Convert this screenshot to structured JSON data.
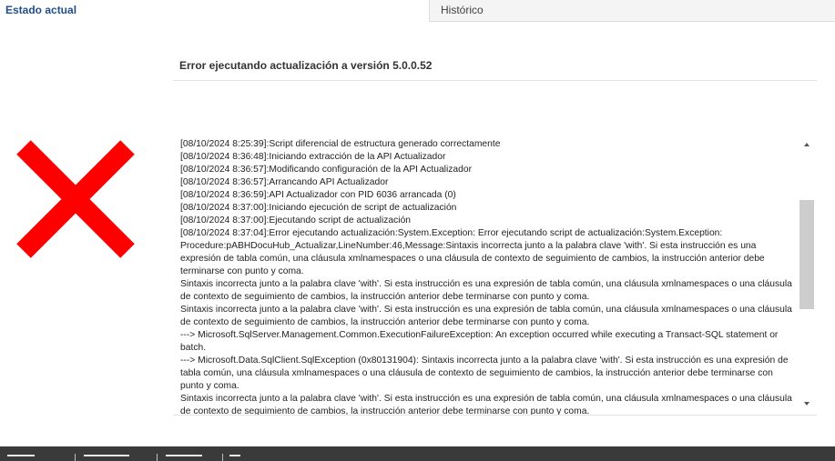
{
  "tabs": {
    "current": "Estado actual",
    "history": "Histórico"
  },
  "status": {
    "heading": "Error ejecutando actualización a versión 5.0.0.52",
    "icon": "error-x-icon",
    "icon_color": "#ff0000"
  },
  "log": {
    "lines": [
      "[08/10/2024 8:25:39]:Script diferencial de estructura generado correctamente",
      "[08/10/2024 8:36:48]:Iniciando extracción de la API Actualizador",
      "[08/10/2024 8:36:57]:Modificando configuración de la API Actualizador",
      "[08/10/2024 8:36:57]:Arrancando API Actualizador",
      "[08/10/2024 8:36:59]:API Actualizador con PID 6036 arrancada (0)",
      "[08/10/2024 8:37:00]:Iniciando ejecución de script de actualización",
      "[08/10/2024 8:37:00]:Ejecutando script de actualización",
      "[08/10/2024 8:37:04]:Error ejecutando actualización:System.Exception: Error ejecutando script de actualización:System.Exception: Procedure:pABHDocuHub_Actualizar,LineNumber:46,Message:Sintaxis incorrecta junto a la palabra clave 'with'. Si esta instrucción es una expresión de tabla común, una cláusula xmlnamespaces o una cláusula de contexto de seguimiento de cambios, la instrucción anterior debe terminarse con punto y coma.",
      "Sintaxis incorrecta junto a la palabra clave 'with'. Si esta instrucción es una expresión de tabla común, una cláusula xmlnamespaces o una cláusula de contexto de seguimiento de cambios, la instrucción anterior debe terminarse con punto y coma.",
      "Sintaxis incorrecta junto a la palabra clave 'with'. Si esta instrucción es una expresión de tabla común, una cláusula xmlnamespaces o una cláusula de contexto de seguimiento de cambios, la instrucción anterior debe terminarse con punto y coma.",
      "   ---> Microsoft.SqlServer.Management.Common.ExecutionFailureException: An exception occurred while executing a Transact-SQL statement or batch.",
      "   ---> Microsoft.Data.SqlClient.SqlException (0x80131904): Sintaxis incorrecta junto a la palabra clave 'with'. Si esta instrucción es una expresión de tabla común, una cláusula xmlnamespaces o una cláusula de contexto de seguimiento de cambios, la instrucción anterior debe terminarse con punto y coma.",
      "Sintaxis incorrecta junto a la palabra clave 'with'. Si esta instrucción es una expresión de tabla común, una cláusula xmlnamespaces o una cláusula de contexto de seguimiento de cambios, la instrucción anterior debe terminarse con punto y coma."
    ]
  },
  "scrollbar": {
    "up_icon": "scroll-up-arrow-icon",
    "down_icon": "scroll-down-arrow-icon"
  }
}
